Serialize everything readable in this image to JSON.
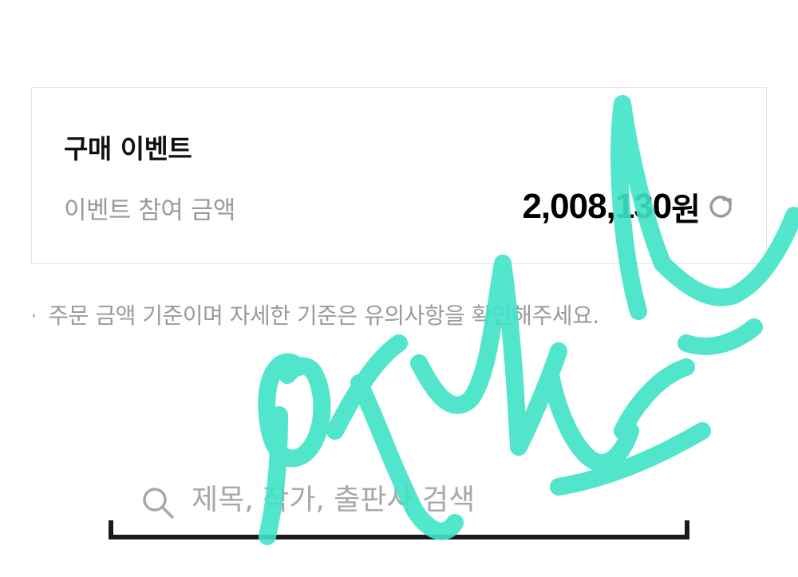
{
  "event_card": {
    "title": "구매 이벤트",
    "amount_label": "이벤트 참여 금액",
    "amount_value": "2,008,130",
    "amount_unit": "원",
    "refresh_icon": "refresh-icon"
  },
  "notice": {
    "bullet": "·",
    "text": "주문 금액 기준이며 자세한 기준은 유의사항을 확인해주세요."
  },
  "search": {
    "icon": "search-icon",
    "placeholder": "제목, 작가, 출판사 검색",
    "value": ""
  },
  "overlay": {
    "type": "handwritten-signature",
    "color": "#3fe3c6"
  }
}
